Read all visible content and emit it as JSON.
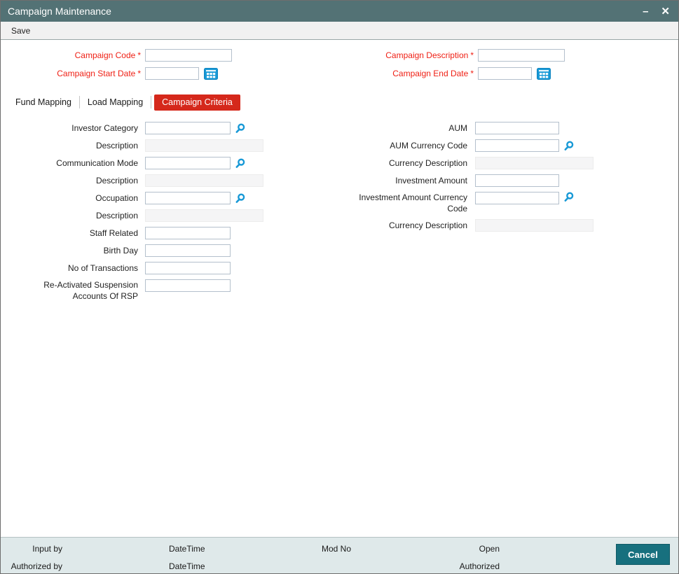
{
  "window": {
    "title": "Campaign Maintenance"
  },
  "icons": {
    "minimize": "–",
    "close": "✕",
    "lookup": "magnifier",
    "date": "calendar"
  },
  "toolbar": {
    "save_label": "Save"
  },
  "header_fields": {
    "campaign_code": {
      "label": "Campaign Code",
      "required": "*",
      "value": ""
    },
    "campaign_description": {
      "label": "Campaign Description",
      "required": "*",
      "value": ""
    },
    "campaign_start_date": {
      "label": "Campaign Start Date",
      "required": "*",
      "value": ""
    },
    "campaign_end_date": {
      "label": "Campaign End Date",
      "required": "*",
      "value": ""
    }
  },
  "tabs": [
    {
      "label": "Fund Mapping",
      "active": false
    },
    {
      "label": "Load Mapping",
      "active": false
    },
    {
      "label": "Campaign Criteria",
      "active": true
    }
  ],
  "criteria": {
    "left": [
      {
        "label": "Investor Category",
        "type": "lookup",
        "value": ""
      },
      {
        "label": "Description",
        "type": "readonly",
        "value": ""
      },
      {
        "label": "Communication Mode",
        "type": "lookup",
        "value": ""
      },
      {
        "label": "Description",
        "type": "readonly",
        "value": ""
      },
      {
        "label": "Occupation",
        "type": "lookup",
        "value": ""
      },
      {
        "label": "Description",
        "type": "readonly",
        "value": ""
      },
      {
        "label": "Staff Related",
        "type": "text",
        "value": ""
      },
      {
        "label": "Birth Day",
        "type": "text",
        "value": ""
      },
      {
        "label": "No of Transactions",
        "type": "text",
        "value": ""
      },
      {
        "label": "Re-Activated Suspension Accounts Of RSP",
        "type": "text",
        "value": ""
      }
    ],
    "right": [
      {
        "label": "AUM",
        "type": "text",
        "value": ""
      },
      {
        "label": "AUM Currency Code",
        "type": "lookup",
        "value": ""
      },
      {
        "label": "Currency Description",
        "type": "readonly",
        "value": ""
      },
      {
        "label": "Investment Amount",
        "type": "text",
        "value": ""
      },
      {
        "label": "Investment Amount Currency Code",
        "type": "lookup",
        "value": ""
      },
      {
        "label": "Currency Description",
        "type": "readonly",
        "value": ""
      }
    ]
  },
  "footer": {
    "input_by": "Input by",
    "datetime1": "DateTime",
    "mod_no": "Mod No",
    "open_status": "Open",
    "authorized_by": "Authorized by",
    "datetime2": "DateTime",
    "authorized_status": "Authorized",
    "cancel_label": "Cancel"
  },
  "colors": {
    "titlebar": "#537275",
    "tab_active_red": "#d5281b",
    "required_red": "#ef1f14",
    "accent_blue": "#1899d6",
    "cancel_button": "#17707e",
    "footer_bg": "#dfe9ea"
  }
}
